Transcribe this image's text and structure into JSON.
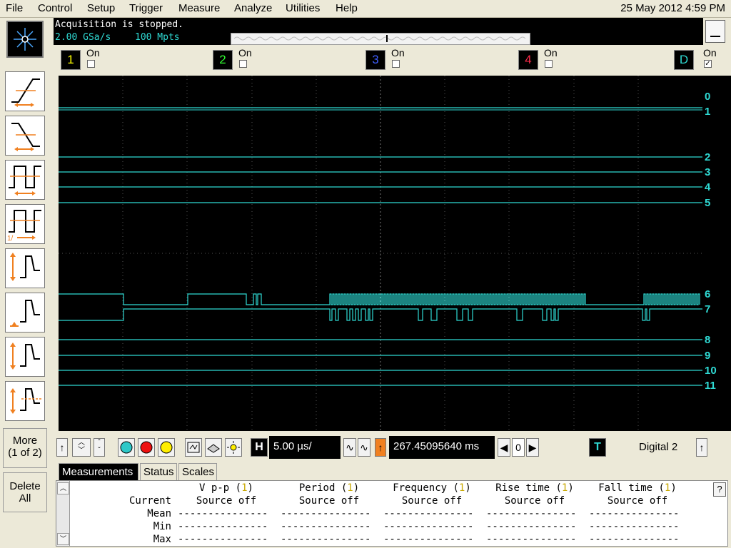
{
  "menu": [
    "File",
    "Control",
    "Setup",
    "Trigger",
    "Measure",
    "Analyze",
    "Utilities",
    "Help"
  ],
  "clock": "25 May 2012  4:59 PM",
  "acquisition": {
    "status": "Acquisition is stopped.",
    "rate": "2.00 GSa/s",
    "memory": "100 Mpts"
  },
  "channels": [
    {
      "num": "1",
      "color": "#ffff00",
      "on_label": "On",
      "checked": false
    },
    {
      "num": "2",
      "color": "#33ff33",
      "on_label": "On",
      "checked": false
    },
    {
      "num": "3",
      "color": "#3f5fff",
      "on_label": "On",
      "checked": false
    },
    {
      "num": "4",
      "color": "#ff2a4a",
      "on_label": "On",
      "checked": false
    },
    {
      "num": "D",
      "color": "#2fdad4",
      "on_label": "On",
      "checked": true
    }
  ],
  "side": {
    "more": "More\n(1 of 2)",
    "more_line1": "More",
    "more_line2": "(1 of 2)",
    "delete_line1": "Delete",
    "delete_line2": "All"
  },
  "lanes": [
    "0",
    "1",
    "2",
    "3",
    "4",
    "5",
    "6",
    "7",
    "8",
    "9",
    "10",
    "11"
  ],
  "controls": {
    "h_label": "H",
    "time_per_div": "5.00 µs/",
    "delay": "267.45095640 ms",
    "zero": "0",
    "t_label": "T",
    "trigger_source": "Digital 2"
  },
  "tabs": [
    "Measurements",
    "Status",
    "Scales"
  ],
  "measurements": {
    "columns": [
      {
        "name": "V p-p",
        "src": "1",
        "state": "Source off"
      },
      {
        "name": "Period",
        "src": "1",
        "state": "Source off"
      },
      {
        "name": "Frequency",
        "src": "1",
        "state": "Source off"
      },
      {
        "name": "Rise time",
        "src": "1",
        "state": "Source off"
      },
      {
        "name": "Fall time",
        "src": "1",
        "state": "Source off"
      }
    ],
    "rows": [
      "Current",
      "Mean",
      "Min",
      "Max"
    ],
    "placeholder": "---------------"
  },
  "colors": {
    "trace": "#2fdad4",
    "grid": "#555555",
    "accent_orange": "#f08020"
  }
}
